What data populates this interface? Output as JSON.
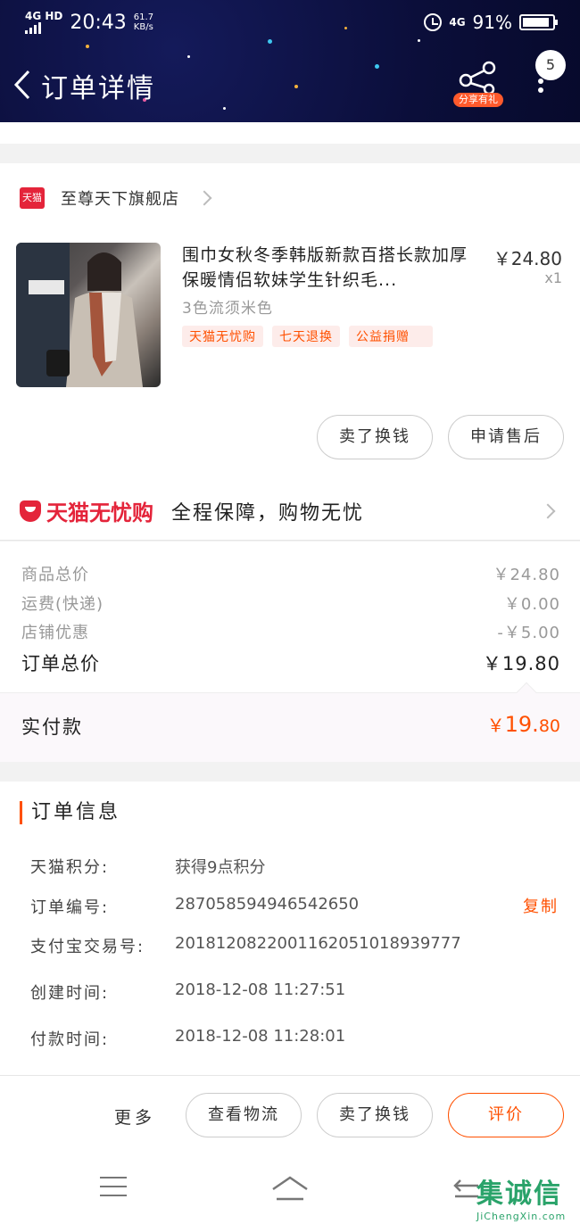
{
  "status_bar": {
    "network": "4G HD",
    "time": "20:43",
    "speed_value": "61.7",
    "speed_unit": "KB/s",
    "network2": "4G",
    "battery": "91%",
    "battery_level": 0.91
  },
  "header": {
    "title": "订单详情",
    "share_label": "分享有礼",
    "badge_count": "5"
  },
  "store": {
    "logo_text": "天猫",
    "name": "至尊天下旗舰店"
  },
  "product": {
    "title": "围巾女秋冬季韩版新款百搭长款加厚保暖情侣软妹学生针织毛...",
    "price": "￥24.80",
    "quantity": "x1",
    "spec": "3色流须米色",
    "tags": [
      "天猫无忧购",
      "七天退换",
      "公益捐赠"
    ]
  },
  "product_actions": {
    "sell": "卖了换钱",
    "after_sale": "申请售后"
  },
  "guarantee": {
    "brand": "天猫无忧购",
    "text": "全程保障，购物无忧"
  },
  "fees": {
    "goods_total_label": "商品总价",
    "goods_total": "￥24.80",
    "shipping_label": "运费(快递)",
    "shipping": "￥0.00",
    "discount_label": "店铺优惠",
    "discount": "-￥5.00",
    "order_total_label": "订单总价",
    "order_total": "￥19.80"
  },
  "paid": {
    "label": "实付款",
    "currency": "￥",
    "amount_int": "19.",
    "amount_dec": "80"
  },
  "order_info": {
    "title": "订单信息",
    "rows": [
      {
        "label": "天猫积分:",
        "value": "获得9点积分"
      },
      {
        "label": "订单编号:",
        "value": "287058594946542650"
      },
      {
        "label": "支付宝交易号:",
        "value": "2018120822001162051018939777"
      },
      {
        "label": "创建时间:",
        "value": "2018-12-08 11:27:51"
      },
      {
        "label": "付款时间:",
        "value": "2018-12-08 11:28:01"
      }
    ],
    "copy_label": "复制"
  },
  "bottom_bar": {
    "more": "更多",
    "logistics": "查看物流",
    "sell": "卖了换钱",
    "review": "评价"
  },
  "watermark": {
    "text": "集诚信",
    "domain": "JiChengXin.com"
  },
  "colors": {
    "accent": "#ff5000",
    "tmall_red": "#e4243a",
    "header_bg": "#0b0e3a"
  }
}
